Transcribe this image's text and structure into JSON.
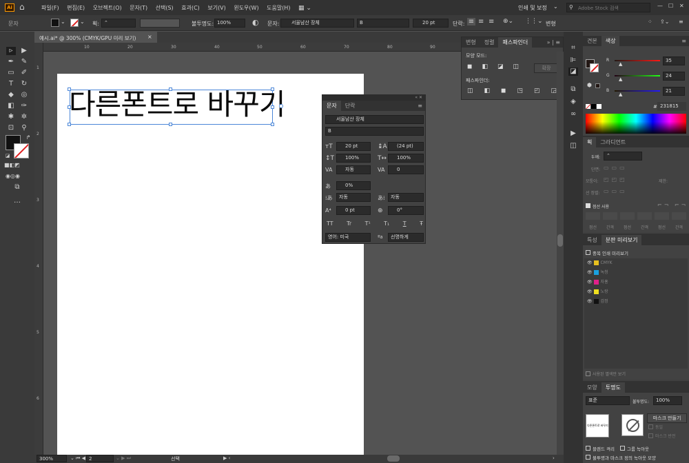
{
  "menubar": {
    "app_icon": "Ai",
    "items": [
      "파일(F)",
      "편집(E)",
      "오브젝트(O)",
      "문자(T)",
      "선택(S)",
      "효과(C)",
      "보기(V)",
      "윈도우(W)",
      "도움말(H)"
    ],
    "workspace": "인쇄 및 보정",
    "search_placeholder": "Adobe Stock 검색"
  },
  "control_bar": {
    "context": "문자",
    "stroke_label": "획:",
    "opacity_label": "불투명도:",
    "opacity_value": "100%",
    "char_label": "문자:",
    "font_name": "서울남산 장체",
    "font_style": "B",
    "font_size": "20 pt",
    "para_label": "단락:",
    "transform_label": "변형"
  },
  "document": {
    "tab_title": "예시.ai* @ 300% (CMYK/GPU 미리 보기)",
    "close": "×",
    "artboard_text": "다른폰트로 바꾸기"
  },
  "ruler": {
    "h_ticks": [
      "10",
      "20",
      "30",
      "40",
      "50",
      "60",
      "70",
      "80",
      "90"
    ],
    "v_ticks": [
      "1",
      "2",
      "3",
      "4",
      "5",
      "6"
    ]
  },
  "character_panel": {
    "tabs": [
      "문자",
      "단락"
    ],
    "font_name": "서울남산 장체",
    "font_style": "B",
    "size": "20 pt",
    "leading": "(24 pt)",
    "vscale": "100%",
    "hscale": "100%",
    "kerning": "자동",
    "tracking": "0",
    "tsume": "0%",
    "aki_left": "자동",
    "aki_right": "자동",
    "baseline": "0 pt",
    "rotation": "0°",
    "style_buttons": [
      "TT",
      "Tr",
      "T¹",
      "T₁",
      "T",
      "Ŧ"
    ],
    "language": "영어: 미국",
    "antialias": "선명하게"
  },
  "pathfinder_panel": {
    "tabs": [
      "변형",
      "정렬",
      "패스파인더"
    ],
    "shape_modes_label": "모양 모드:",
    "expand_label": "확장",
    "pathfinders_label": "패스파인더:"
  },
  "color_panel": {
    "tabs": [
      "견본",
      "색상"
    ],
    "channels": [
      {
        "label": "R",
        "value": "35",
        "color": "#e02020"
      },
      {
        "label": "G",
        "value": "24",
        "color": "#20c020"
      },
      {
        "label": "B",
        "value": "21",
        "color": "#2a3ae0"
      }
    ],
    "hex_label": "#",
    "hex_value": "231815"
  },
  "stroke_panel": {
    "tabs": [
      "획",
      "그라디언트"
    ],
    "weight_label": "두께:",
    "cap_label": "단면:",
    "corner_label": "모퉁이:",
    "limit_label": "제한:",
    "align_label": "선 정렬:",
    "dashed_label": "점선 사용",
    "dash_fields": [
      "점선",
      "간격",
      "점선",
      "간격",
      "점선",
      "간격"
    ]
  },
  "separations_panel": {
    "tabs": [
      "특성",
      "분판 미리보기"
    ],
    "overprint_label": "중복 인쇄 미리보기",
    "inks": [
      {
        "name": "CMYK",
        "color": "#e8c020"
      },
      {
        "name": "녹청",
        "color": "#1aa0e0"
      },
      {
        "name": "자홍",
        "color": "#e0208a"
      },
      {
        "name": "노랑",
        "color": "#f0e020"
      },
      {
        "name": "검정",
        "color": "#111111"
      }
    ],
    "spot_label": "사용된 별색만 보기"
  },
  "transparency_panel": {
    "tabs": [
      "모양",
      "투명도"
    ],
    "blend_mode": "표준",
    "opacity_label": "불투명도:",
    "opacity_value": "100%",
    "thumb_text": "다른폰트로 바꾸기",
    "make_mask": "마스크 만들기",
    "clip_label": "동일",
    "invert_label": "마스크 반전",
    "isolate_label": "블렌드 격리",
    "knockout_label": "그룹 녹아웃",
    "opacity_mask_label": "불투명과 마스크 정의 녹아웃 모양"
  },
  "status_bar": {
    "zoom": "300%",
    "page": "2",
    "mode": "선택"
  }
}
